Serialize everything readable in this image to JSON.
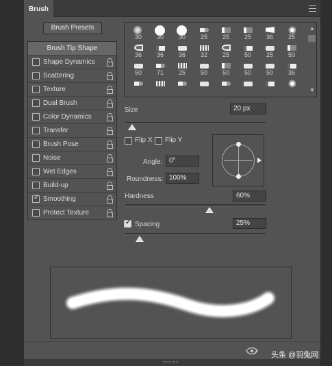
{
  "panel": {
    "tab_title": "Brush"
  },
  "buttons": {
    "brush_presets": "Brush Presets"
  },
  "sidebar": {
    "header": "Brush Tip Shape",
    "items": [
      {
        "label": "Shape Dynamics",
        "checked": false
      },
      {
        "label": "Scattering",
        "checked": false
      },
      {
        "label": "Texture",
        "checked": false
      },
      {
        "label": "Dual Brush",
        "checked": false
      },
      {
        "label": "Color Dynamics",
        "checked": false
      },
      {
        "label": "Transfer",
        "checked": false
      },
      {
        "label": "Brush Pose",
        "checked": false
      },
      {
        "label": "Noise",
        "checked": false
      },
      {
        "label": "Wet Edges",
        "checked": false
      },
      {
        "label": "Build-up",
        "checked": false
      },
      {
        "label": "Smoothing",
        "checked": true
      },
      {
        "label": "Protect Texture",
        "checked": false
      }
    ]
  },
  "brush_grid": {
    "rows": [
      [
        "30",
        "30",
        "30",
        "25",
        "25",
        "25",
        "36",
        "25"
      ],
      [
        "36",
        "36",
        "36",
        "32",
        "25",
        "50",
        "25",
        "50"
      ],
      [
        "50",
        "71",
        "25",
        "50",
        "50",
        "50",
        "50",
        "36"
      ],
      [
        "",
        "",
        "",
        "",
        "",
        "",
        "",
        ""
      ]
    ],
    "tips": [
      [
        "soft",
        "hard",
        "hard",
        "b1",
        "b2",
        "b2",
        "b3",
        "b8"
      ],
      [
        "b5",
        "b7",
        "b6",
        "b4",
        "b5",
        "b7",
        "b6",
        "b2"
      ],
      [
        "b6",
        "b1",
        "b4",
        "b6",
        "b2",
        "b6",
        "b6",
        "b7"
      ],
      [
        "b1",
        "b4",
        "b1",
        "b6",
        "b1",
        "b6",
        "b7",
        "b8"
      ]
    ]
  },
  "size": {
    "label": "Size",
    "value": "20 px",
    "slider_fraction": 0.05
  },
  "flip": {
    "x_label": "Flip X",
    "y_label": "Flip Y",
    "x_checked": false,
    "y_checked": false
  },
  "angle": {
    "label": "Angle:",
    "value": "0°"
  },
  "roundness": {
    "label": "Roundness:",
    "value": "100%"
  },
  "hardness": {
    "label": "Hardness",
    "value": "60%",
    "slider_fraction": 0.6
  },
  "spacing": {
    "label": "Spacing",
    "value": "25%",
    "checked": true,
    "slider_fraction": 0.1
  },
  "watermark": {
    "text": "头条 @羽兔网"
  },
  "colors": {
    "panel_bg": "#535353",
    "field_bg": "#444444",
    "text": "#d6d6d6"
  }
}
